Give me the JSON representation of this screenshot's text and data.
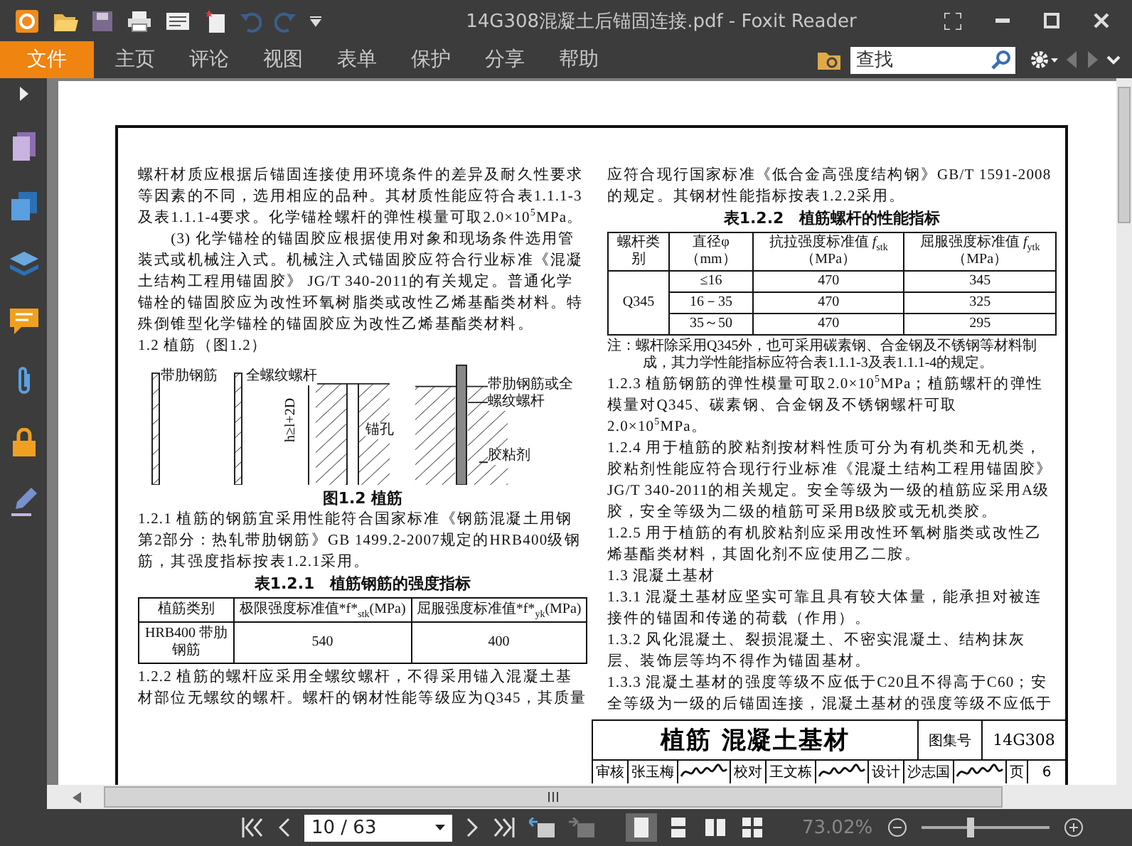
{
  "window": {
    "title": "14G308混凝土后锚固连接.pdf - Foxit Reader"
  },
  "menu": {
    "file": "文件",
    "items": [
      "主页",
      "评论",
      "视图",
      "表单",
      "保护",
      "分享",
      "帮助"
    ],
    "search": {
      "placeholder": "查找"
    }
  },
  "document": {
    "left": [
      {
        "kind": "paragraph",
        "text": "螺杆材质应根据后锚固连接使用环境条件的差异及耐久性要求等因素的不同，选用相应的品种。其材质性能应符合表1.1.1-3及表1.1.1-4要求。化学锚栓螺杆的弹性模量可取2.0×10$^{5}$MPa。"
      },
      {
        "kind": "indented",
        "text": "(3) 化学锚栓的锚固胶应根据使用对象和现场条件选用管装式或机械注入式。机械注入式锚固胶应符合行业标准《混凝土结构工程用锚固胶》 JG/T 340-2011的有关规定。普通化学锚栓的锚固胶应为改性环氧树脂类或改性乙烯基酯类材料。特殊倒锥型化学锚栓的锚固胶应为改性乙烯基酯类材料。"
      },
      {
        "kind": "heading",
        "text": "1.2 植筋（图1.2）"
      },
      {
        "kind": "figure",
        "labels": [
          "带肋钢筋",
          "全螺纹螺杆",
          "h≥l+2D",
          "锚孔",
          "带肋钢筋或全螺纹螺杆",
          "胶粘剂"
        ]
      },
      {
        "kind": "caption",
        "text": "图1.2 植筋"
      },
      {
        "kind": "paragraph",
        "text": "1.2.1 植筋的钢筋宜采用性能符合国家标准《钢筋混凝土用钢第2部分：热轧带肋钢筋》GB 1499.2-2007规定的HRB400级钢筋，其强度指标按表1.2.1采用。"
      },
      {
        "kind": "caption",
        "text": "表1.2.1　植筋钢筋的强度指标"
      },
      {
        "kind": "table",
        "columns": [
          "植筋类别",
          "极限强度标准值*f*$_{stk}$(MPa)",
          "屈服强度标准值*f*$_{yk}$(MPa)"
        ],
        "rows": [
          [
            "HRB400 带肋钢筋",
            "540",
            "400"
          ]
        ]
      },
      {
        "kind": "paragraph",
        "text": "1.2.2 植筋的螺杆应采用全螺纹螺杆，不得采用锚入混凝土基材部位无螺纹的螺杆。螺杆的钢材性能等级应为Q345，其质量"
      }
    ],
    "right": [
      {
        "kind": "paragraph",
        "text": "应符合现行国家标准《低合金高强度结构钢》GB/T 1591-2008的规定。其钢材性能指标按表1.2.2采用。"
      },
      {
        "kind": "caption",
        "text": "表1.2.2　植筋螺杆的性能指标"
      },
      {
        "kind": "grouped-table",
        "columns": [
          "螺杆类别",
          "直径φ（mm）",
          "抗拉强度标准值 *f*$_{stk}$（MPa）",
          "屈服强度标准值 *f*$_{ytk}$（MPa）"
        ],
        "rows": [
          [
            "",
            "≤16",
            "470",
            "345"
          ],
          [
            "Q345",
            "16－35",
            "470",
            "325"
          ],
          [
            "",
            "35～50",
            "470",
            "295"
          ]
        ]
      },
      {
        "kind": "note",
        "text": "注：螺杆除采用Q345外，也可采用碳素钢、合金钢及不锈钢等材料制成，其力学性能指标应符合表1.1.1-3及表1.1.1-4的规定。"
      },
      {
        "kind": "paragraph",
        "text": "1.2.3 植筋钢筋的弹性模量可取2.0×10$^{5}$MPa；植筋螺杆的弹性模量对Q345、碳素钢、合金钢及不锈钢螺杆可取2.0×10$^{5}$MPa。"
      },
      {
        "kind": "paragraph",
        "text": "1.2.4 用于植筋的胶粘剂按材料性质可分为有机类和无机类，胶粘剂性能应符合现行行业标准《混凝土结构工程用锚固胶》JG/T 340-2011的相关规定。安全等级为一级的植筋应采用A级胶，安全等级为二级的植筋可采用B级胶或无机类胶。"
      },
      {
        "kind": "paragraph",
        "text": "1.2.5 用于植筋的有机胶粘剂应采用改性环氧树脂类或改性乙烯基酯类材料，其固化剂不应使用乙二胺。"
      },
      {
        "kind": "heading",
        "text": "1.3 混凝土基材"
      },
      {
        "kind": "paragraph",
        "text": "1.3.1 混凝土基材应坚实可靠且具有较大体量，能承担对被连接件的锚固和传递的荷载（作用）。"
      },
      {
        "kind": "paragraph",
        "text": "1.3.2 风化混凝土、裂损混凝土、不密实混凝土、结构抹灰层、装饰层等均不得作为锚固基材。"
      },
      {
        "kind": "paragraph",
        "text": "1.3.3 混凝土基材的强度等级不应低于C20且不得高于C60；安全等级为一级的后锚固连接，混凝土基材的强度等级不应低于"
      }
    ],
    "title_block": {
      "title": "植筋 混凝土基材",
      "atlas_label": "图集号",
      "atlas_number": "14G308",
      "signoffs": [
        {
          "role": "审核",
          "name": "张玉梅"
        },
        {
          "role": "校对",
          "name": "王文栋"
        },
        {
          "role": "设计",
          "name": "沙志国"
        }
      ],
      "page_label": "页",
      "page": "6"
    }
  },
  "navigation": {
    "page": "10 / 63",
    "view_modes": [
      {
        "selected": true
      },
      {
        "selected": false
      },
      {
        "selected": false
      },
      {
        "selected": false
      }
    ],
    "zoom": "73.02%",
    "zoom_slider": {
      "level": 0.36
    }
  }
}
